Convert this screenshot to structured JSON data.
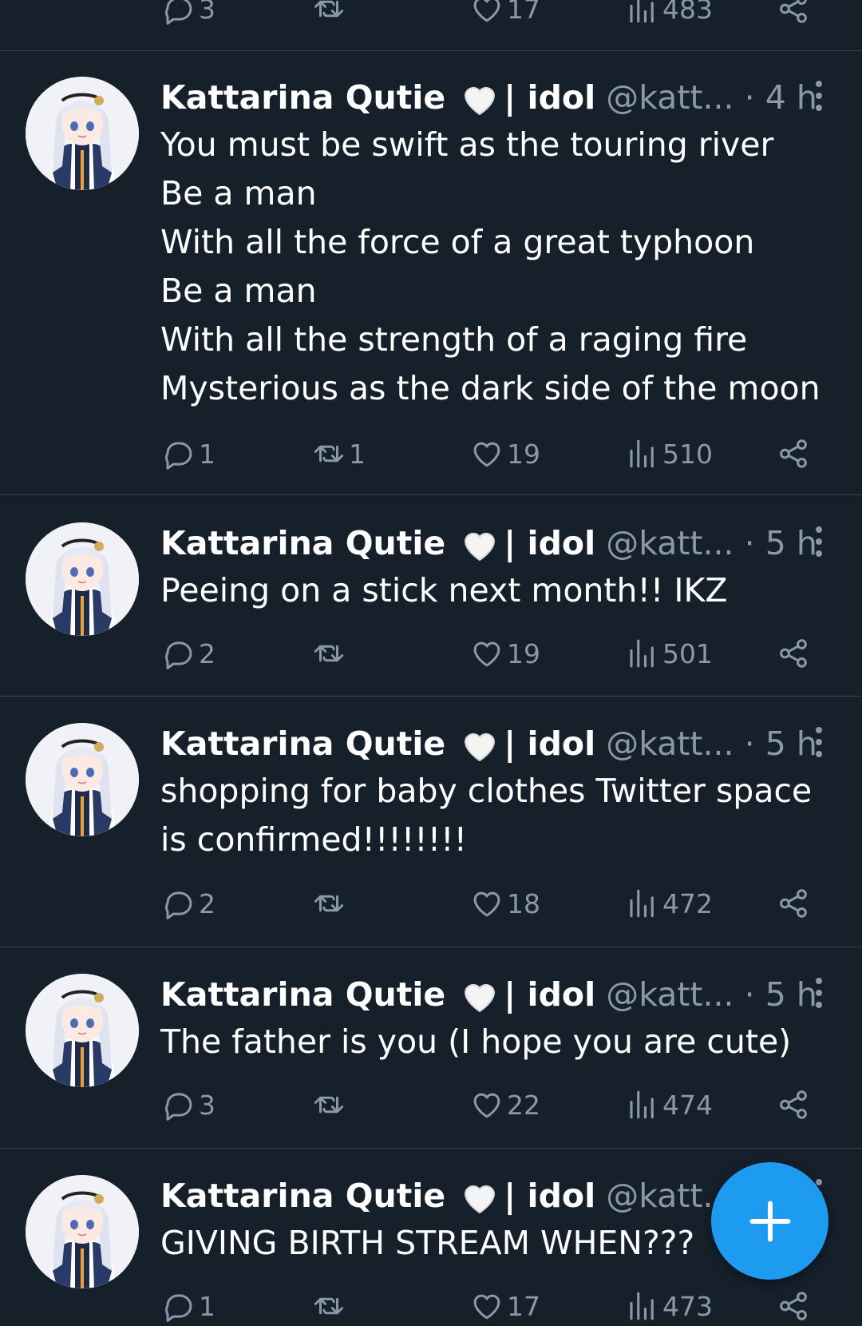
{
  "colors": {
    "background": "#15202b",
    "divider": "#38444d",
    "muted": "#8b98a5",
    "accent": "#1d9bf0"
  },
  "partial_tweet": {
    "replies": "3",
    "retweets": "",
    "likes": "17",
    "views": "483"
  },
  "tweets": [
    {
      "name": "Kattarina Qutie",
      "heart": "🤍",
      "tag": "| idol",
      "handle": "@katt...",
      "dot": "·",
      "time": "4 h",
      "text": "You must be swift as the touring river\nBe a man\nWith all the force of a great typhoon\nBe a man\nWith all the strength of a raging fire\nMysterious as the dark side of the moon",
      "replies": "1",
      "retweets": "1",
      "likes": "19",
      "views": "510"
    },
    {
      "name": "Kattarina Qutie",
      "heart": "🤍",
      "tag": "| idol",
      "handle": "@katt...",
      "dot": "·",
      "time": "5 h",
      "text": "Peeing on a stick next month!! IKZ",
      "replies": "2",
      "retweets": "",
      "likes": "19",
      "views": "501"
    },
    {
      "name": "Kattarina Qutie",
      "heart": "🤍",
      "tag": "| idol",
      "handle": "@katt...",
      "dot": "·",
      "time": "5 h",
      "text": "shopping for baby clothes Twitter space\nis confirmed!!!!!!!!",
      "replies": "2",
      "retweets": "",
      "likes": "18",
      "views": "472"
    },
    {
      "name": "Kattarina Qutie",
      "heart": "🤍",
      "tag": "| idol",
      "handle": "@katt...",
      "dot": "·",
      "time": "5 h",
      "text": "The father is you (I hope you are cute)",
      "replies": "3",
      "retweets": "",
      "likes": "22",
      "views": "474"
    },
    {
      "name": "Kattarina Qutie",
      "heart": "🤍",
      "tag": "| idol",
      "handle": "@katt...",
      "dot": "",
      "time": "",
      "text": "GIVING BIRTH STREAM WHEN???",
      "replies": "1",
      "retweets": "",
      "likes": "17",
      "views": "473"
    }
  ],
  "fab": {
    "icon": "plus-icon"
  }
}
